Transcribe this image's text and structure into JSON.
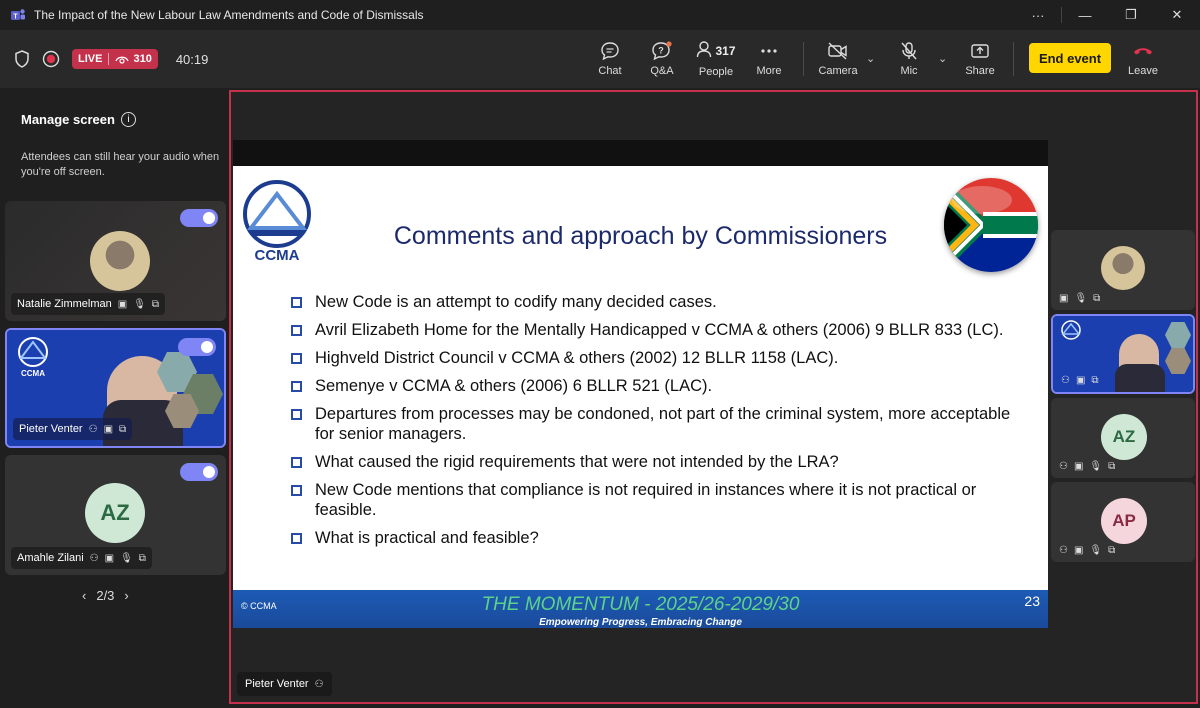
{
  "window": {
    "title": "The Impact of the New Labour Law Amendments and Code of Dismissals"
  },
  "toolbar": {
    "live_label": "LIVE",
    "viewer_count": "310",
    "timer": "40:19",
    "chat_label": "Chat",
    "qa_label": "Q&A",
    "people_label": "People",
    "people_count": "317",
    "more_label": "More",
    "camera_label": "Camera",
    "mic_label": "Mic",
    "share_label": "Share",
    "end_event_label": "End event",
    "leave_label": "Leave",
    "accent": "#ffd600",
    "live_color": "#c4314b"
  },
  "left_panel": {
    "title": "Manage screen",
    "description": "Attendees can still hear your audio when you're off screen.",
    "participants": [
      {
        "name": "Natalie Zimmelman"
      },
      {
        "name": "Pieter Venter"
      },
      {
        "name": "Amahle Zilani",
        "initials": "AZ"
      }
    ],
    "pager": "2/3"
  },
  "slide": {
    "logo_text": "CCMA",
    "title": "Comments and approach by Commissioners",
    "bullets": [
      "New Code is an attempt to codify many decided cases.",
      "Avril Elizabeth Home for the Mentally Handicapped v CCMA & others (2006) 9 BLLR 833 (LC).",
      "Highveld District Council v CCMA & others (2002) 12 BLLR 1158 (LAC).",
      "Semenye v CCMA & others (2006) 6 BLLR 521 (LAC).",
      "Departures from processes may be condoned, not part of the criminal system, more acceptable for senior managers.",
      "What caused the rigid requirements that were not intended by the LRA?",
      "New Code mentions that compliance is not required in instances where it is not practical or feasible.",
      "What is practical and feasible?"
    ],
    "footer_copyright": "© CCMA",
    "footer_title": "THE MOMENTUM - 2025/26-2029/30",
    "footer_subtitle": "Empowering Progress, Embracing Change",
    "page_number": "23"
  },
  "stage": {
    "presenter_name": "Pieter Venter"
  },
  "right_panel": {
    "tiles": [
      {
        "initials": ""
      },
      {
        "initials": ""
      },
      {
        "initials": "AZ",
        "color": "#cfe8d6"
      },
      {
        "initials": "AP",
        "color": "#f6d6dd"
      }
    ]
  }
}
